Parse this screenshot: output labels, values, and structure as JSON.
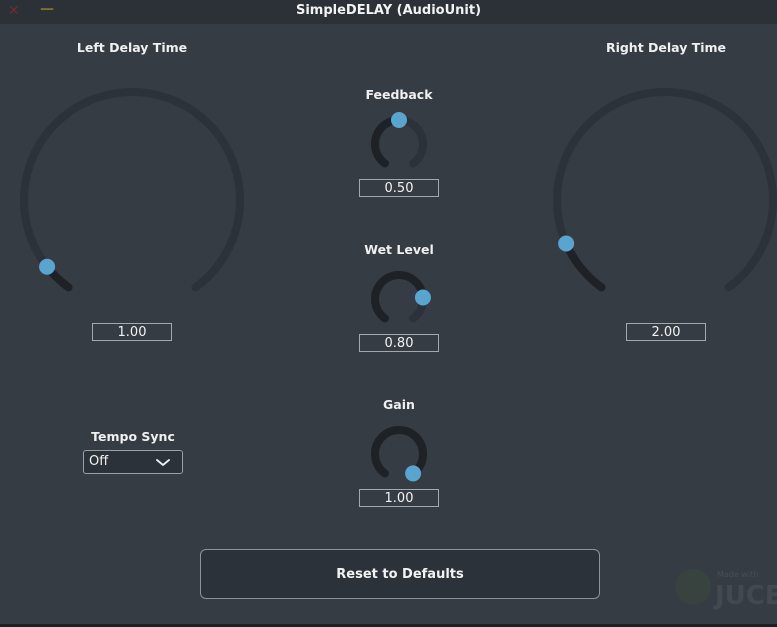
{
  "window": {
    "title": "SimpleDELAY (AudioUnit)",
    "close_icon": "close-icon",
    "minimize_icon": "minimize-icon"
  },
  "colors": {
    "background": "#363c44",
    "track": "#2c3239",
    "fill": "#1e2226",
    "thumb": "#58a6d0"
  },
  "knobs": {
    "left_delay": {
      "label": "Left Delay Time",
      "value_text": "1.00",
      "proportion": 0.055
    },
    "right_delay": {
      "label": "Right Delay Time",
      "value_text": "2.00",
      "proportion": 0.105
    },
    "feedback": {
      "label": "Feedback",
      "value_text": "0.50",
      "proportion": 0.5
    },
    "wet_level": {
      "label": "Wet Level",
      "value_text": "0.80",
      "proportion": 0.8
    },
    "gain": {
      "label": "Gain",
      "value_text": "1.00",
      "proportion": 1.0
    }
  },
  "tempo_sync": {
    "label": "Tempo Sync",
    "selected": "Off",
    "icon": "chevron-down-icon"
  },
  "reset_button": {
    "label": "Reset to Defaults"
  },
  "watermark": {
    "text_top": "Made with",
    "text_main": "JUCE"
  }
}
